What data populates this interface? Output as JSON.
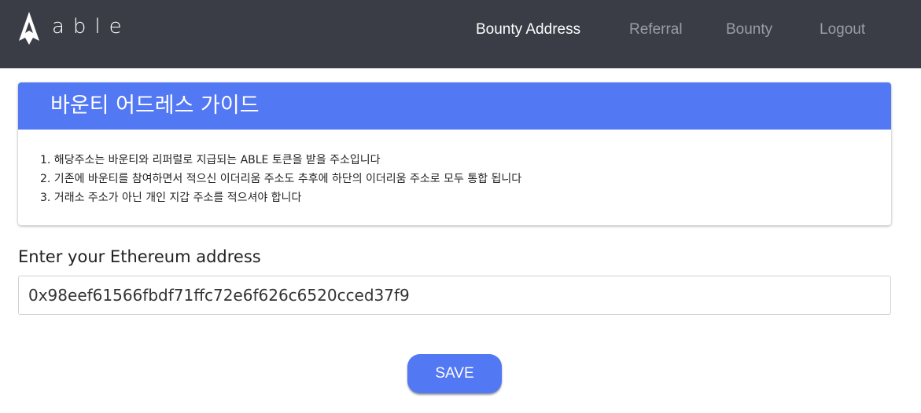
{
  "header": {
    "logo_text": "able",
    "logo_icon": "able-logo-icon",
    "nav": [
      {
        "label": "Bounty Address",
        "active": true
      },
      {
        "label": "Referral",
        "active": false
      },
      {
        "label": "Bounty",
        "active": false
      },
      {
        "label": "Logout",
        "active": false
      }
    ]
  },
  "guide": {
    "title": "바운티 어드레스 가이드",
    "lines": [
      "1. 해당주소는 바운티와 리퍼럴로 지급되는 ABLE 토큰을 받을 주소입니다",
      "2. 기존에 바운티를 참여하면서 적으신 이더리움 주소도 추후에 하단의 이더리움 주소로 모두 통합 됩니다",
      "3. 거래소 주소가 아닌 개인 지갑 주소를 적으셔야 합니다"
    ]
  },
  "form": {
    "label": "Enter your Ethereum address",
    "address_value": "0x98eef61566fbdf71ffc72e6f626c6520cced37f9",
    "save_label": "SAVE"
  },
  "colors": {
    "navbar": "#3a3d45",
    "accent": "#5278f4",
    "nav_active": "#ffffff",
    "nav_inactive": "#9a9da3"
  }
}
